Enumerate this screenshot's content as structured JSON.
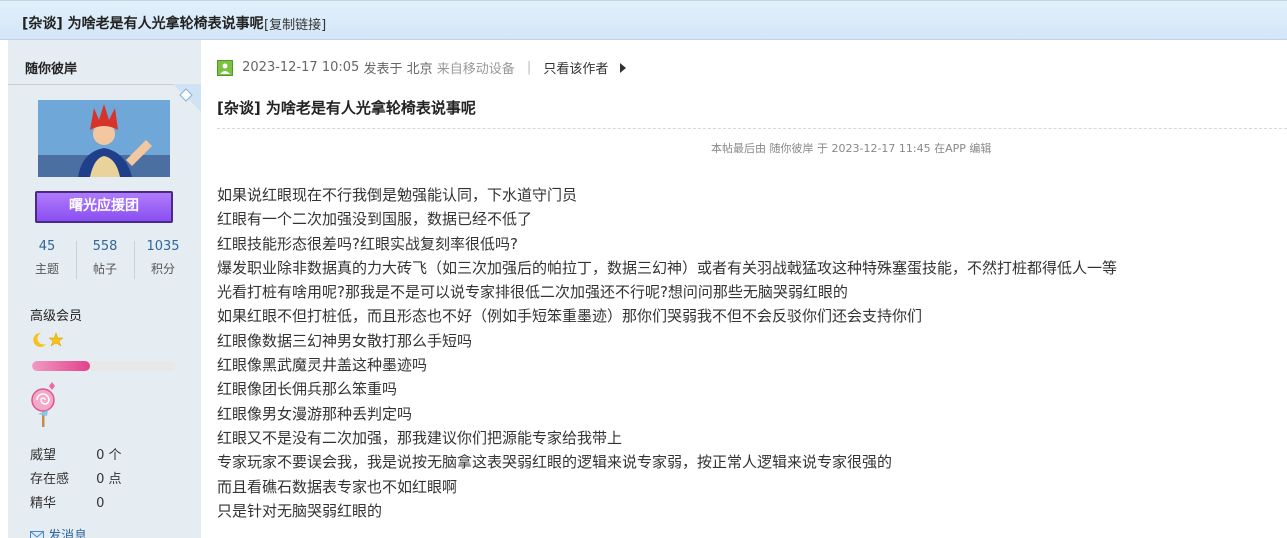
{
  "header": {
    "title": "[杂谈] 为啥老是有人光拿轮椅表说事呢",
    "copy_link": "[复制链接]"
  },
  "sidebar": {
    "username": "随你彼岸",
    "group_badge": "曙光应援团",
    "stats": [
      {
        "value": "45",
        "label": "主题"
      },
      {
        "value": "558",
        "label": "帖子"
      },
      {
        "value": "1035",
        "label": "积分"
      }
    ],
    "level": "高级会员",
    "progress_percent": 40,
    "details": [
      {
        "label": "威望",
        "value": "0 个"
      },
      {
        "label": "存在感",
        "value": "0 点"
      },
      {
        "label": "精华",
        "value": "0"
      }
    ],
    "send_message": "发消息"
  },
  "post": {
    "date": "2023-12-17 10:05",
    "posted_in": "发表于 北京",
    "from_device": "来自移动设备",
    "separator": "|",
    "only_author": "只看该作者",
    "title": "[杂谈] 为啥老是有人光拿轮椅表说事呢",
    "edit_note": "本帖最后由 随你彼岸 于 2023-12-17 11:45 在APP 编辑",
    "lines": [
      "如果说红眼现在不行我倒是勉强能认同，下水道守门员",
      "红眼有一个二次加强没到国服，数据已经不低了",
      "红眼技能形态很差吗?红眼实战复刻率很低吗?",
      "爆发职业除非数据真的力大砖飞（如三次加强后的帕拉丁，数据三幻神）或者有关羽战戟猛攻这种特殊塞蛋技能，不然打桩都得低人一等",
      "光看打桩有啥用呢?那我是不是可以说专家排很低二次加强还不行呢?想问问那些无脑哭弱红眼的",
      "如果红眼不但打桩低，而且形态也不好（例如手短笨重墨迹）那你们哭弱我不但不会反驳你们还会支持你们",
      "红眼像数据三幻神男女散打那么手短吗",
      "红眼像黑武魔灵井盖这种墨迹吗",
      "红眼像团长佣兵那么笨重吗",
      "红眼像男女漫游那种丢判定吗",
      "红眼又不是没有二次加强，那我建议你们把源能专家给我带上",
      "专家玩家不要误会我，我是说按无脑拿这表哭弱红眼的逻辑来说专家弱，按正常人逻辑来说专家很强的",
      "而且看礁石数据表专家也不如红眼啊",
      "只是针对无脑哭弱红眼的"
    ]
  },
  "colors": {
    "header_bg": "#d3e6f7",
    "sidebar_bg": "#e5edf2",
    "badge_purple": "#9a5cf5",
    "link_blue": "#336699",
    "progress_pink": "#e2418c"
  }
}
